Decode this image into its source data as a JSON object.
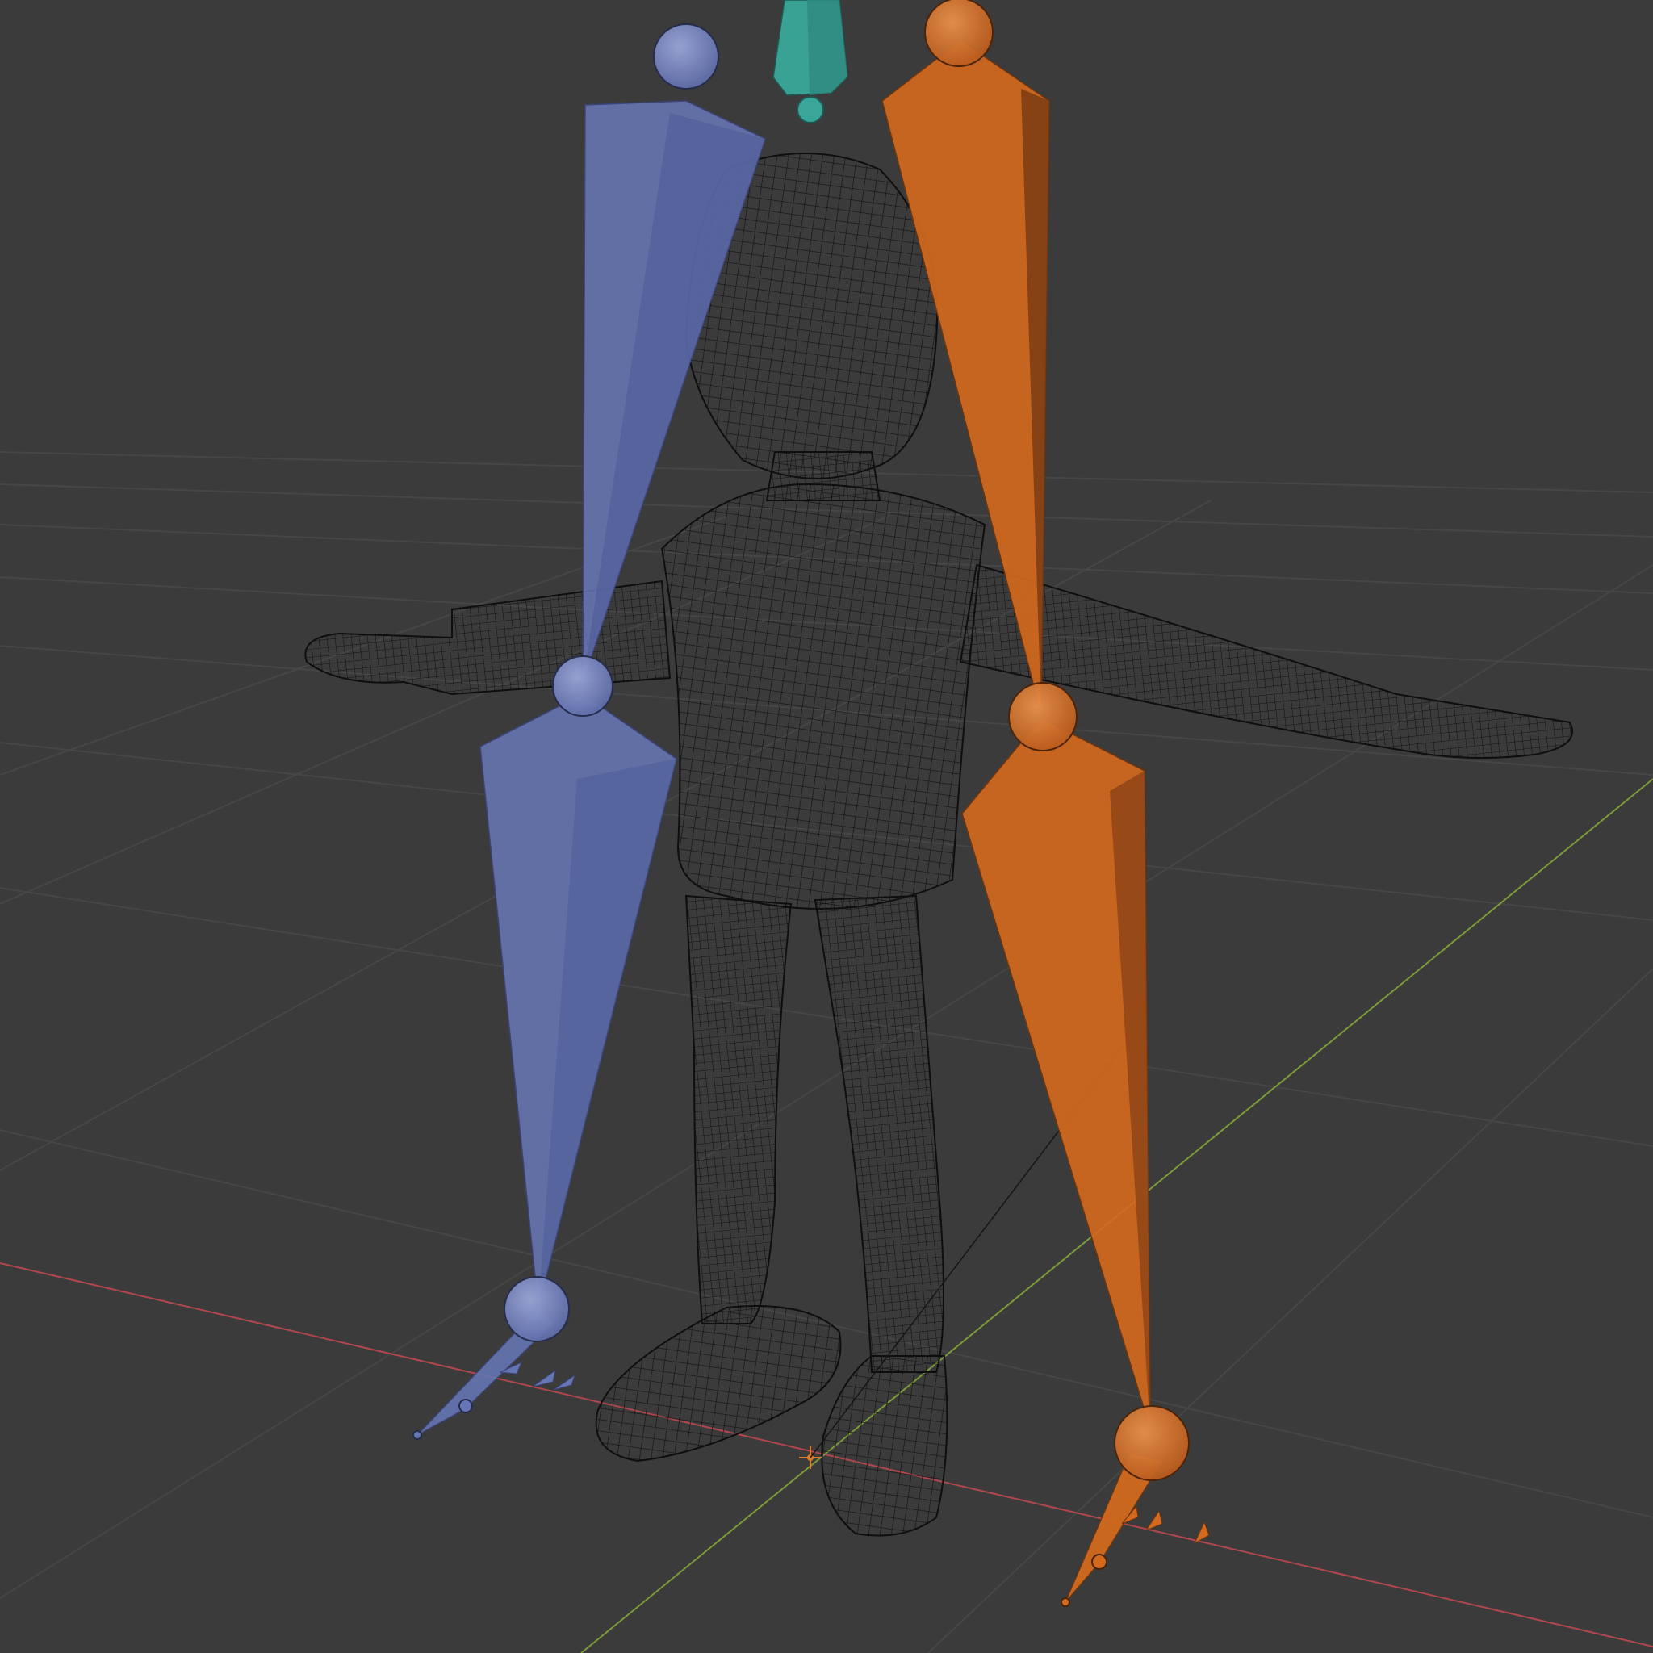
{
  "viewport": {
    "background": "#3b3b3b",
    "grid_color": "#474747",
    "x_axis_color": "#b0474c",
    "y_axis_color": "#7c9a3a",
    "mesh_color": "#111111",
    "mode": "wireframe"
  },
  "armature": {
    "left_side_color": "#6676b4",
    "right_side_color": "#d2691e",
    "head_bone_color": "#3aa69a",
    "bones": [
      {
        "side": "left",
        "name": "left-upper-leg-bone"
      },
      {
        "side": "left",
        "name": "left-lower-leg-bone"
      },
      {
        "side": "left",
        "name": "left-foot-bone"
      },
      {
        "side": "right",
        "name": "right-upper-leg-bone"
      },
      {
        "side": "right",
        "name": "right-lower-leg-bone"
      },
      {
        "side": "right",
        "name": "right-foot-bone"
      },
      {
        "side": "center",
        "name": "head-bone"
      }
    ]
  },
  "object_origin_icon": "crosshair-icon"
}
